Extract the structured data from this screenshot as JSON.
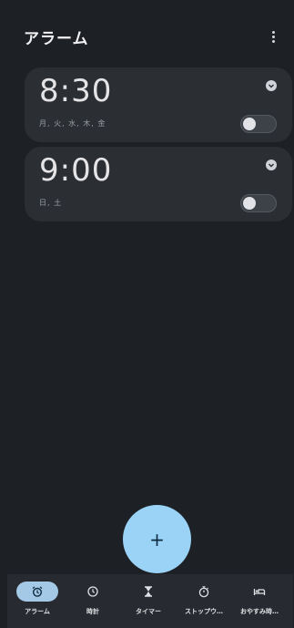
{
  "header": {
    "title": "アラーム"
  },
  "alarms": [
    {
      "time": "8:30",
      "days": "月, 火, 水, 木, 金",
      "enabled": false
    },
    {
      "time": "9:00",
      "days": "日, 土",
      "enabled": false
    }
  ],
  "fab": {
    "label": "+"
  },
  "nav": {
    "items": [
      {
        "label": "アラーム",
        "icon": "alarm-icon"
      },
      {
        "label": "時計",
        "icon": "clock-icon"
      },
      {
        "label": "タイマー",
        "icon": "hourglass-icon"
      },
      {
        "label": "ストップウ…",
        "icon": "stopwatch-icon"
      },
      {
        "label": "おやすみ時…",
        "icon": "bed-icon"
      }
    ],
    "active": 0
  },
  "colors": {
    "background": "#1d2024",
    "card": "#2b2f34",
    "accent": "#9bd3f7",
    "nav_active": "#a3c9e6"
  }
}
